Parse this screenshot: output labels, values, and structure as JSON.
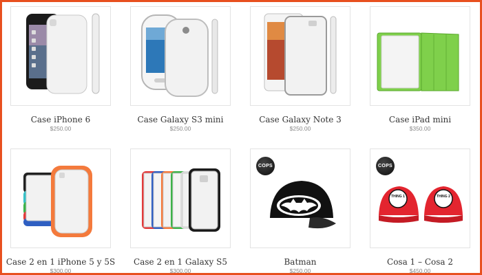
{
  "products": [
    {
      "name": "Case iPhone 6",
      "price": "$250.00",
      "image": "iphone6-case-icon"
    },
    {
      "name": "Case Galaxy S3 mini",
      "price": "$250.00",
      "image": "galaxy-s3-mini-case-icon"
    },
    {
      "name": "Case Galaxy Note 3",
      "price": "$250.00",
      "image": "galaxy-note3-case-icon"
    },
    {
      "name": "Case iPad mini",
      "price": "$350.00",
      "image": "ipad-mini-case-icon"
    },
    {
      "name": "Case 2 en 1 iPhone 5 y 5S",
      "price": "$300.00",
      "image": "iphone5-2in1-case-icon"
    },
    {
      "name": "Case 2 en 1 Galaxy S5",
      "price": "$300.00",
      "image": "galaxy-s5-2in1-case-icon"
    },
    {
      "name": "Batman",
      "price": "$250.00",
      "image": "batman-cap-icon",
      "badge": "COPS"
    },
    {
      "name": "Cosa 1 – Cosa 2",
      "price": "$450.00",
      "image": "thing1-thing2-caps-icon",
      "badge": "COPS",
      "cap_labels": [
        "THING 1",
        "THING 2"
      ]
    }
  ],
  "colors": {
    "frame": "#e8501f",
    "case_white": "#f2f2f2",
    "ipad_green": "#7fd04b",
    "cap_red": "#e3252f",
    "cap_black": "#111111"
  }
}
